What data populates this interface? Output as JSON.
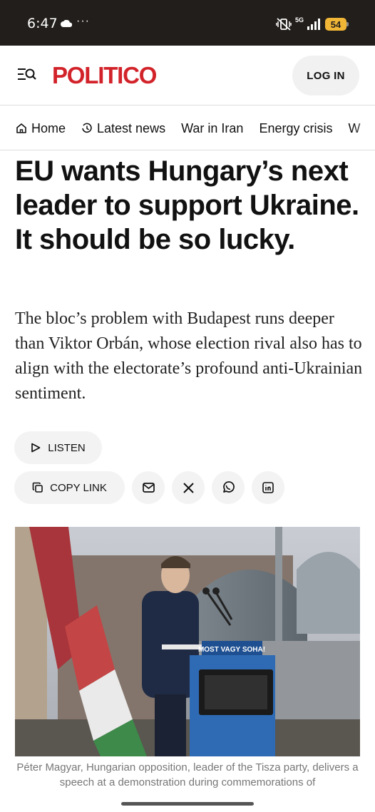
{
  "status_bar": {
    "time": "6:47",
    "dots": "···",
    "network": "5G",
    "battery": "54",
    "battery_color": "#f2b636"
  },
  "header": {
    "logo": "POLITICO",
    "logo_color": "#d2232a",
    "login_label": "LOG IN",
    "menu_icon": "menu-search-icon"
  },
  "nav": {
    "items": [
      {
        "label": "Home",
        "icon": "home-icon"
      },
      {
        "label": "Latest news",
        "icon": "clock-icon"
      },
      {
        "label": "War in Iran"
      },
      {
        "label": "Energy crisis"
      },
      {
        "label": "W"
      }
    ]
  },
  "article": {
    "headline": "EU wants Hungary’s next leader to support Ukraine. It should be so lucky.",
    "dek": "The bloc’s problem with Budapest runs deeper than Viktor Orbán, whose election rival also has to align with the electorate’s profound anti-Ukrainian sentiment.",
    "listen_label": "LISTEN",
    "copy_link_label": "COPY LINK",
    "share_icons": [
      "email-icon",
      "x-icon",
      "whatsapp-icon",
      "linkedin-icon"
    ],
    "photo": {
      "sign_text": "MOST VAGY SOHA!"
    },
    "caption": "Péter Magyar, Hungarian opposition, leader of the Tisza party, delivers a speech at a demonstration during commemorations of"
  }
}
